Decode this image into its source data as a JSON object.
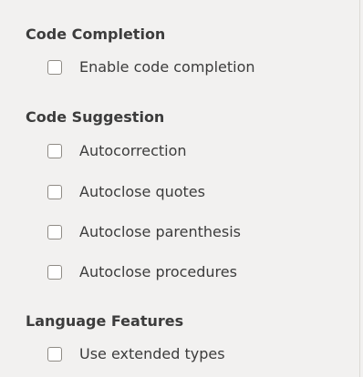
{
  "sections": [
    {
      "title": "Code Completion",
      "options": [
        {
          "label": "Enable code completion",
          "checked": false
        }
      ]
    },
    {
      "title": "Code Suggestion",
      "options": [
        {
          "label": "Autocorrection",
          "checked": false
        },
        {
          "label": "Autoclose quotes",
          "checked": false
        },
        {
          "label": "Autoclose parenthesis",
          "checked": false
        },
        {
          "label": "Autoclose procedures",
          "checked": false
        }
      ]
    },
    {
      "title": "Language Features",
      "options": [
        {
          "label": "Use extended types",
          "checked": false
        }
      ]
    }
  ]
}
